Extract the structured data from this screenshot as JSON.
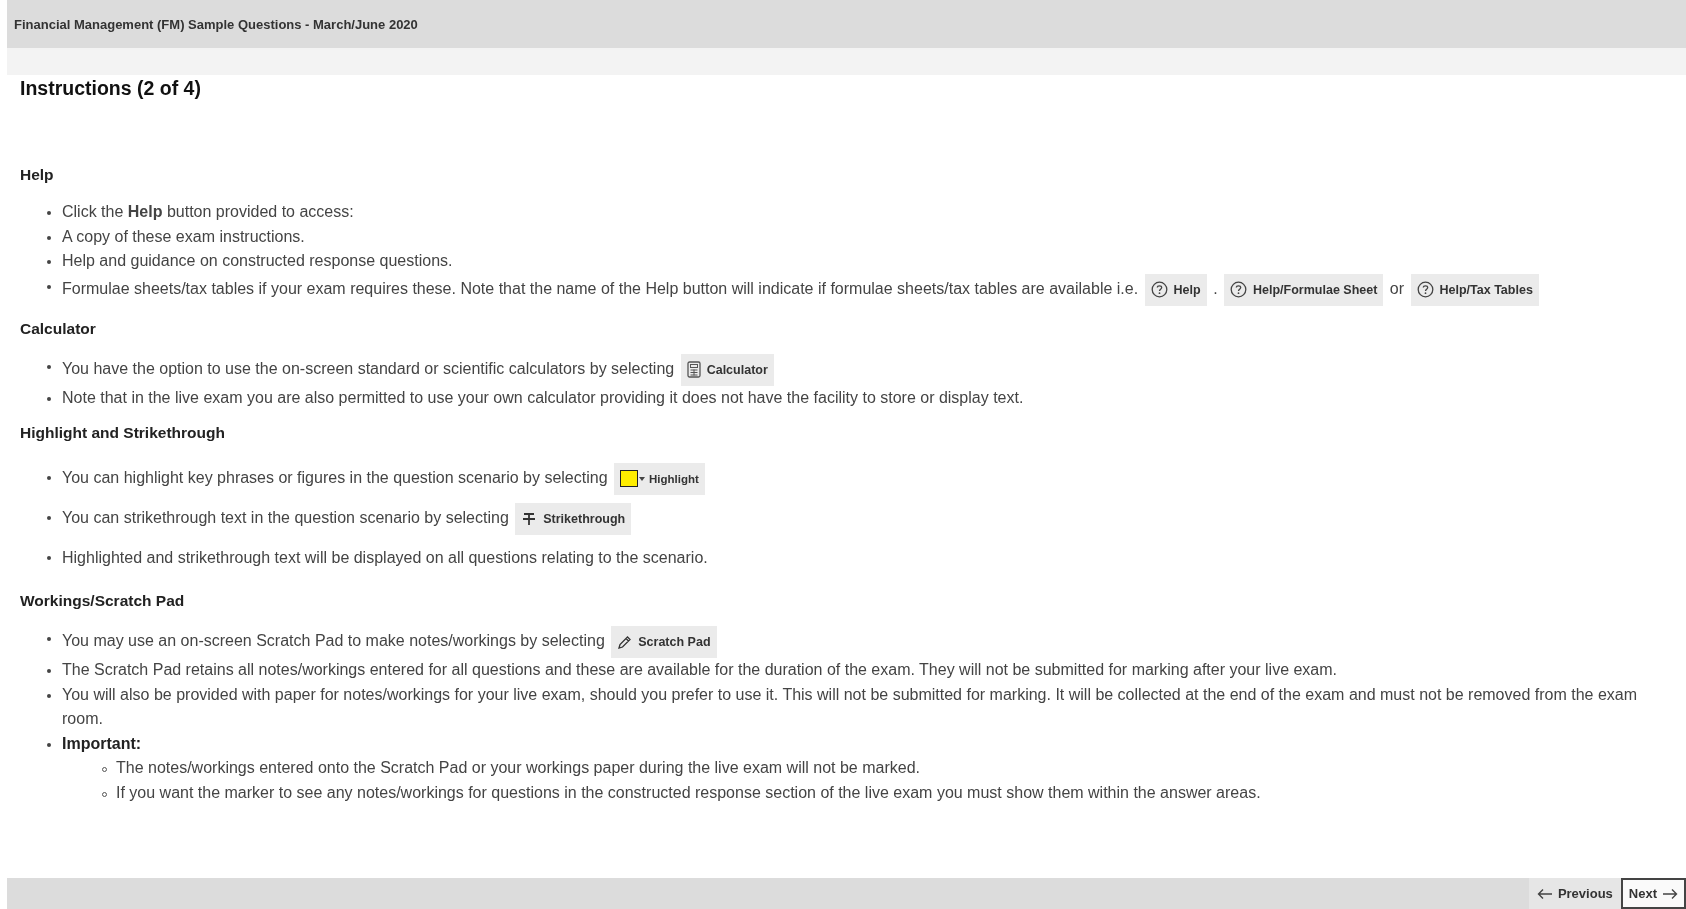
{
  "header": {
    "title": "Financial Management (FM) Sample Questions - March/June 2020"
  },
  "page_title": "Instructions (2 of 4)",
  "sections": [
    {
      "heading": "Help",
      "items": [
        {
          "segments": [
            {
              "kind": "text",
              "text": "Click the **Help** button provided to access:"
            }
          ]
        },
        {
          "segments": [
            {
              "kind": "text",
              "text": "A copy of these exam instructions."
            }
          ]
        },
        {
          "segments": [
            {
              "kind": "text",
              "text": "Help and guidance on constructed response questions."
            }
          ]
        },
        {
          "segments": [
            {
              "kind": "text",
              "text": "Formulae sheets/tax tables if your exam requires these. Note that the name of the Help button will indicate if formulae sheets/tax tables are available i.e."
            },
            {
              "kind": "help-button",
              "label": "Help"
            },
            {
              "kind": "text",
              "text": "."
            },
            {
              "kind": "help-button",
              "label": "Help/Formulae Sheet"
            },
            {
              "kind": "text",
              "text": "or"
            },
            {
              "kind": "help-button",
              "label": "Help/Tax Tables"
            }
          ]
        }
      ]
    },
    {
      "heading": "Calculator",
      "items": [
        {
          "segments": [
            {
              "kind": "text",
              "text": "You have the option to use the on-screen standard or scientific calculators by selecting"
            },
            {
              "kind": "calculator-button",
              "label": "Calculator"
            }
          ]
        },
        {
          "segments": [
            {
              "kind": "text",
              "text": "Note that in the live exam you are also permitted to use your own calculator providing it does not have the facility to store or display text."
            }
          ]
        }
      ]
    },
    {
      "heading": "Highlight and Strikethrough",
      "items": [
        {
          "segments": [
            {
              "kind": "text",
              "text": "You can highlight key phrases or figures in the question scenario by selecting"
            },
            {
              "kind": "highlight-button",
              "label": "Highlight",
              "color": "#ffee00"
            }
          ]
        },
        {
          "segments": [
            {
              "kind": "text",
              "text": "You can strikethrough text in the question scenario by selecting"
            },
            {
              "kind": "strikethrough-button",
              "label": "Strikethrough"
            }
          ]
        },
        {
          "segments": [
            {
              "kind": "text",
              "text": "Highlighted and strikethrough text will be displayed on all questions relating to the scenario."
            }
          ]
        }
      ]
    },
    {
      "heading": "Workings/Scratch Pad",
      "items": [
        {
          "segments": [
            {
              "kind": "text",
              "text": "You may use an on-screen Scratch Pad to make notes/workings by selecting"
            },
            {
              "kind": "scratchpad-button",
              "label": "Scratch Pad"
            }
          ]
        },
        {
          "segments": [
            {
              "kind": "text",
              "text": "The Scratch Pad retains all notes/workings entered for all questions and these are available for the duration of the exam. They will not be submitted for marking after your live exam."
            }
          ]
        },
        {
          "segments": [
            {
              "kind": "text",
              "text": "You will also be provided with paper for notes/workings for your live exam, should you prefer to use it. This will not be submitted for marking.  It will be collected at the end of the exam and must not be removed from the exam room."
            }
          ]
        },
        {
          "bold": true,
          "segments": [
            {
              "kind": "text",
              "text": "Important:"
            }
          ],
          "children": [
            {
              "segments": [
                {
                  "kind": "text",
                  "text": "The notes/workings entered onto the Scratch Pad or your workings paper during the live exam will not be marked."
                }
              ]
            },
            {
              "segments": [
                {
                  "kind": "text",
                  "text": "If you want the marker to see any notes/workings for questions in the constructed response section of the live exam you must show them within the answer areas."
                }
              ]
            }
          ]
        }
      ]
    }
  ],
  "footer": {
    "buttons": [
      {
        "kind": "previous",
        "label": "Previous",
        "focused": false
      },
      {
        "kind": "next",
        "label": "Next",
        "focused": true
      }
    ]
  }
}
